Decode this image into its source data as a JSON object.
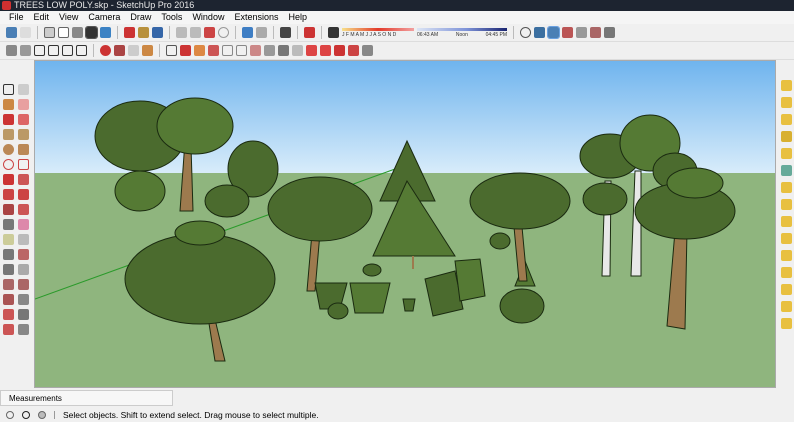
{
  "window": {
    "title": "TREES LOW POLY.skp - SketchUp Pro 2016"
  },
  "menu": [
    "File",
    "Edit",
    "View",
    "Camera",
    "Draw",
    "Tools",
    "Window",
    "Extensions",
    "Help"
  ],
  "shadows": {
    "months": "J F M A M J J A S O N D",
    "time_start": "06:43 AM",
    "time_mid": "Noon",
    "time_end": "04:45 PM"
  },
  "measurements": {
    "label": "Measurements"
  },
  "status": {
    "message": "Select objects. Shift to extend select. Drag mouse to select multiple."
  },
  "colors": {
    "sky_top": "#6fb4ee",
    "sky_bottom": "#d8ecfa",
    "ground": "#8fb57e",
    "foliage": "#4b6b2e",
    "trunk": "#9d7a4e"
  }
}
